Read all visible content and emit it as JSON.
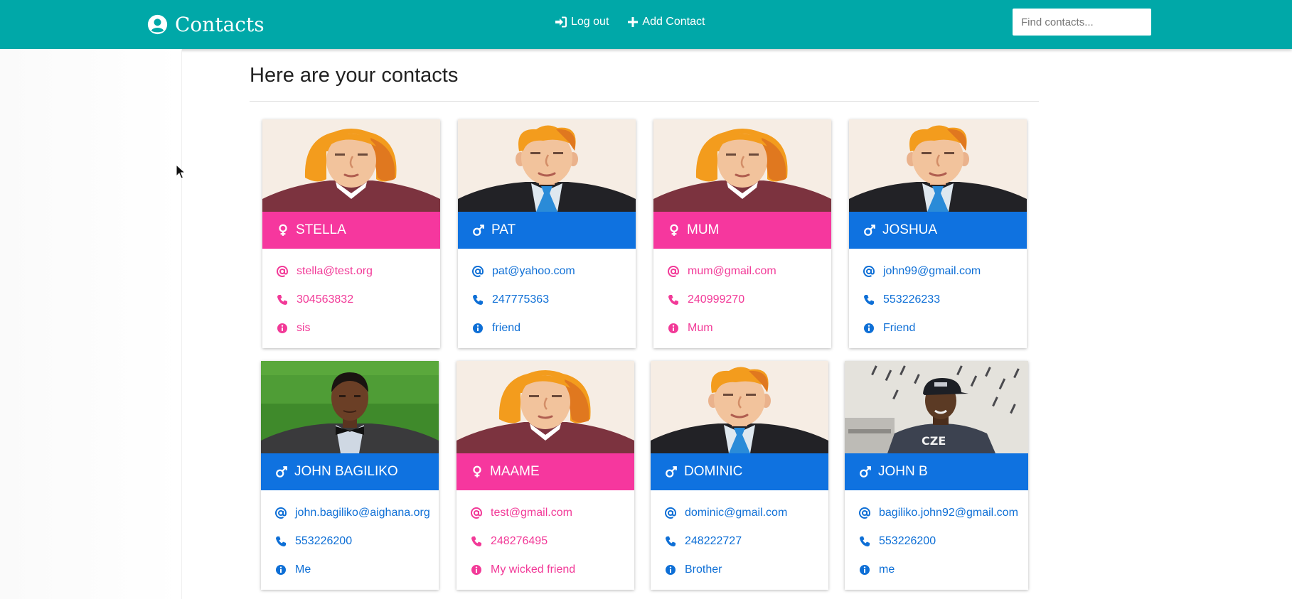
{
  "navbar": {
    "brand": "Contacts",
    "links": [
      {
        "label": "Log out",
        "icon": "sign-in-icon"
      },
      {
        "label": "Add Contact",
        "icon": "plus-icon"
      }
    ],
    "search_placeholder": "Find contacts..."
  },
  "page": {
    "heading": "Here are your contacts"
  },
  "contacts": [
    {
      "name": "STELLA",
      "gender": "female",
      "email": "stella@test.org",
      "phone": "304563832",
      "type": "sis",
      "photo": "female-avatar"
    },
    {
      "name": "PAT",
      "gender": "male",
      "email": "pat@yahoo.com",
      "phone": "247775363",
      "type": "friend",
      "photo": "male-avatar"
    },
    {
      "name": "MUM",
      "gender": "female",
      "email": "mum@gmail.com",
      "phone": "240999270",
      "type": "Mum",
      "photo": "female-avatar"
    },
    {
      "name": "JOSHUA",
      "gender": "male",
      "email": "john99@gmail.com",
      "phone": "553226233",
      "type": "Friend",
      "photo": "male-avatar"
    },
    {
      "name": "JOHN BAGILIKO",
      "gender": "male",
      "email": "john.bagiliko@aighana.org",
      "phone": "553226200",
      "type": "Me",
      "photo": "photo-man-bowtie"
    },
    {
      "name": "MAAME",
      "gender": "female",
      "email": "test@gmail.com",
      "phone": "248276495",
      "type": "My wicked friend",
      "photo": "female-avatar"
    },
    {
      "name": "DOMINIC",
      "gender": "male",
      "email": "dominic@gmail.com",
      "phone": "248222727",
      "type": "Brother",
      "photo": "male-avatar"
    },
    {
      "name": "JOHN B",
      "gender": "male",
      "email": "bagiliko.john92@gmail.com",
      "phone": "553226200",
      "type": "me",
      "photo": "photo-man-cap"
    }
  ],
  "colors": {
    "navbar": "#00a8a8",
    "female": "#f6379e",
    "male": "#0f72e0"
  }
}
